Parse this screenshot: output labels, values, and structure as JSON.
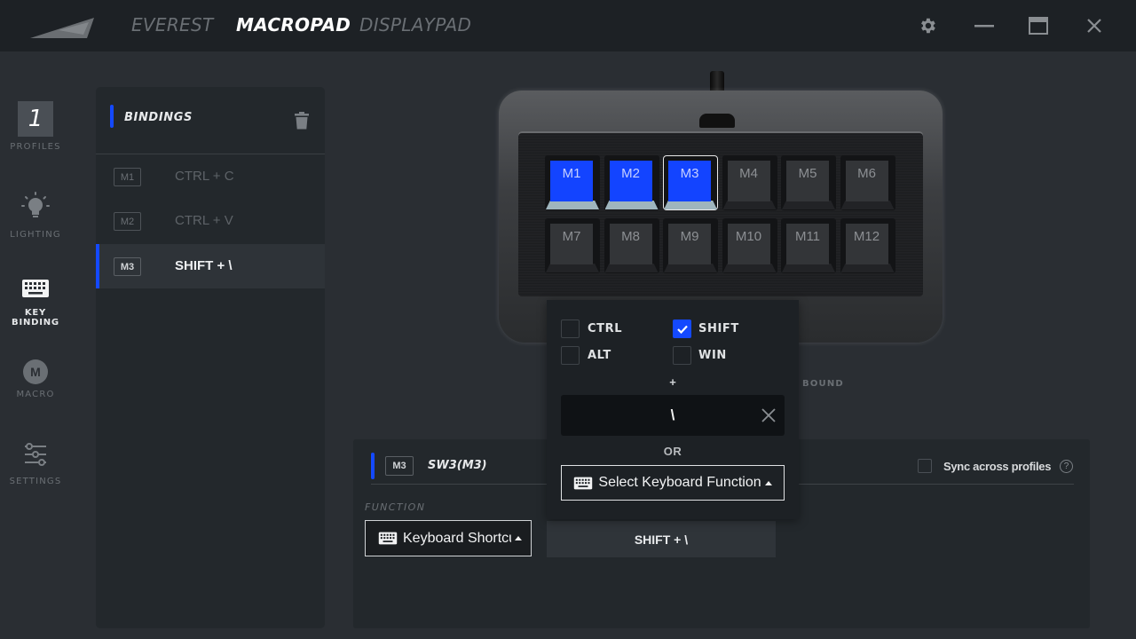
{
  "titlebar": {
    "tabs": [
      {
        "label": "EVEREST",
        "active": false
      },
      {
        "label": "MACROPAD",
        "active": true
      },
      {
        "label": "DISPLAYPAD",
        "active": false
      }
    ],
    "icons": [
      "gear-icon",
      "minimize-icon",
      "maximize-icon",
      "close-icon"
    ]
  },
  "sidebar": {
    "profile_number": "1",
    "items": [
      {
        "label": "PROFILES",
        "icon": "profile-number"
      },
      {
        "label": "LIGHTING",
        "icon": "lightbulb-icon"
      },
      {
        "label": "KEY BINDING",
        "icon": "keyboard-icon",
        "active": true
      },
      {
        "label": "MACRO",
        "icon": "macro-m-icon",
        "glyph": "M"
      },
      {
        "label": "SETTINGS",
        "icon": "sliders-icon"
      }
    ]
  },
  "bindings": {
    "title": "BINDINGS",
    "rows": [
      {
        "key": "M1",
        "value": "CTRL + C",
        "selected": false
      },
      {
        "key": "M2",
        "value": "CTRL + V",
        "selected": false
      },
      {
        "key": "M3",
        "value": "SHIFT + \\",
        "selected": true
      }
    ]
  },
  "device": {
    "keys": [
      {
        "label": "M1",
        "bound": true
      },
      {
        "label": "M2",
        "bound": true
      },
      {
        "label": "M3",
        "bound": true,
        "selected": true
      },
      {
        "label": "M4",
        "bound": false
      },
      {
        "label": "M5",
        "bound": false
      },
      {
        "label": "M6",
        "bound": false
      },
      {
        "label": "M7",
        "bound": false
      },
      {
        "label": "M8",
        "bound": false
      },
      {
        "label": "M9",
        "bound": false
      },
      {
        "label": "M10",
        "bound": false
      },
      {
        "label": "M11",
        "bound": false
      },
      {
        "label": "M12",
        "bound": false
      }
    ],
    "legend_bound": "BOUND",
    "bound_color": "#1344ff"
  },
  "editor": {
    "key_badge": "M3",
    "key_name": "SW3(M3)",
    "sync_label": "Sync across profiles",
    "sync_checked": false,
    "help_glyph": "?",
    "function_label": "FUNCTION",
    "function_value": "Keyboard Shortcut",
    "shortcut_value": "SHIFT + \\"
  },
  "popup": {
    "modifiers": [
      {
        "label": "CTRL",
        "checked": false
      },
      {
        "label": "SHIFT",
        "checked": true
      },
      {
        "label": "ALT",
        "checked": false
      },
      {
        "label": "WIN",
        "checked": false
      }
    ],
    "plus": "+",
    "key_value": "\\",
    "or_label": "OR",
    "select_function_label": "Select Keyboard Function"
  },
  "colors": {
    "accent": "#1449ff",
    "titlebar_bg": "#1d2125",
    "app_bg": "#2a2e33",
    "panel_bg": "#23282c"
  }
}
